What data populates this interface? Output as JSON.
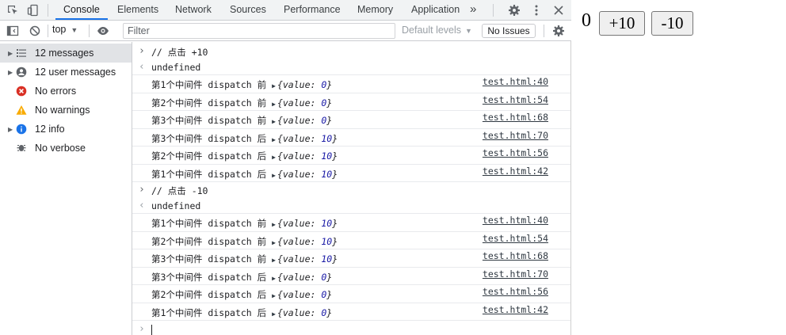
{
  "devtools": {
    "tabs": [
      {
        "label": "Console",
        "active": true
      },
      {
        "label": "Elements",
        "active": false
      },
      {
        "label": "Network",
        "active": false
      },
      {
        "label": "Sources",
        "active": false
      },
      {
        "label": "Performance",
        "active": false
      },
      {
        "label": "Memory",
        "active": false
      },
      {
        "label": "Application",
        "active": false
      }
    ],
    "more_tabs": "»",
    "toolbar": {
      "context": "top",
      "filter_placeholder": "Filter",
      "levels": "Default levels",
      "issues": "No Issues"
    },
    "sidebar": [
      {
        "label": "12 messages",
        "icon": "list-icon",
        "expandable": true,
        "selected": true
      },
      {
        "label": "12 user messages",
        "icon": "user-icon",
        "expandable": true,
        "selected": false
      },
      {
        "label": "No errors",
        "icon": "error-icon",
        "expandable": false,
        "selected": false
      },
      {
        "label": "No warnings",
        "icon": "warning-icon",
        "expandable": false,
        "selected": false
      },
      {
        "label": "12 info",
        "icon": "info-icon",
        "expandable": true,
        "selected": false
      },
      {
        "label": "No verbose",
        "icon": "verbose-icon",
        "expandable": false,
        "selected": false
      }
    ],
    "console": [
      {
        "kind": "input",
        "text": "// 点击 +10"
      },
      {
        "kind": "result",
        "text": "undefined"
      },
      {
        "kind": "log",
        "msg": "第1个中间件 dispatch 前",
        "obj_key": "value",
        "obj_val": "0",
        "src": "test.html:40"
      },
      {
        "kind": "log",
        "msg": "第2个中间件 dispatch 前",
        "obj_key": "value",
        "obj_val": "0",
        "src": "test.html:54"
      },
      {
        "kind": "log",
        "msg": "第3个中间件 dispatch 前",
        "obj_key": "value",
        "obj_val": "0",
        "src": "test.html:68"
      },
      {
        "kind": "log",
        "msg": "第3个中间件 dispatch 后",
        "obj_key": "value",
        "obj_val": "10",
        "src": "test.html:70"
      },
      {
        "kind": "log",
        "msg": "第2个中间件 dispatch 后",
        "obj_key": "value",
        "obj_val": "10",
        "src": "test.html:56"
      },
      {
        "kind": "log",
        "msg": "第1个中间件 dispatch 后",
        "obj_key": "value",
        "obj_val": "10",
        "src": "test.html:42"
      },
      {
        "kind": "input",
        "text": "// 点击 -10"
      },
      {
        "kind": "result",
        "text": "undefined"
      },
      {
        "kind": "log",
        "msg": "第1个中间件 dispatch 前",
        "obj_key": "value",
        "obj_val": "10",
        "src": "test.html:40"
      },
      {
        "kind": "log",
        "msg": "第2个中间件 dispatch 前",
        "obj_key": "value",
        "obj_val": "10",
        "src": "test.html:54"
      },
      {
        "kind": "log",
        "msg": "第3个中间件 dispatch 前",
        "obj_key": "value",
        "obj_val": "10",
        "src": "test.html:68"
      },
      {
        "kind": "log",
        "msg": "第3个中间件 dispatch 后",
        "obj_key": "value",
        "obj_val": "0",
        "src": "test.html:70"
      },
      {
        "kind": "log",
        "msg": "第2个中间件 dispatch 后",
        "obj_key": "value",
        "obj_val": "0",
        "src": "test.html:56"
      },
      {
        "kind": "log",
        "msg": "第1个中间件 dispatch 后",
        "obj_key": "value",
        "obj_val": "0",
        "src": "test.html:42"
      }
    ]
  },
  "page": {
    "counter": "0",
    "plus_label": "+10",
    "minus_label": "-10"
  },
  "colors": {
    "accent": "#1a73e8",
    "error": "#d93025",
    "warning": "#f9ab00",
    "info": "#1a73e8",
    "comment": "#236e25",
    "number": "#1a1aa6"
  }
}
